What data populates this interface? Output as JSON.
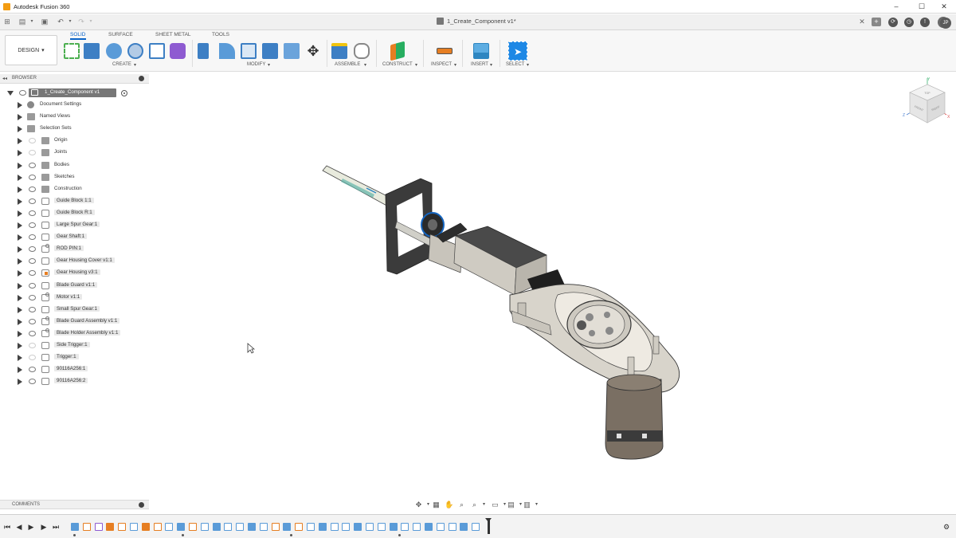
{
  "window": {
    "app_title": "Autodesk Fusion 360",
    "document_title": "1_Create_Component v1*",
    "user_initials": "JP"
  },
  "toolbar": {
    "workspace_label": "DESIGN",
    "tabs": [
      "SOLID",
      "SURFACE",
      "SHEET METAL",
      "TOOLS"
    ],
    "active_tab": "SOLID",
    "groups": [
      "CREATE",
      "MODIFY",
      "ASSEMBLE",
      "CONSTRUCT",
      "INSPECT",
      "INSERT",
      "SELECT"
    ]
  },
  "browser": {
    "header": "BROWSER",
    "root": "1_Create_Component v1",
    "items": [
      {
        "label": "Document Settings"
      },
      {
        "label": "Named Views"
      },
      {
        "label": "Selection Sets"
      },
      {
        "label": "Origin"
      },
      {
        "label": "Joints"
      },
      {
        "label": "Bodies"
      },
      {
        "label": "Sketches"
      },
      {
        "label": "Construction"
      },
      {
        "label": "Guide Block 1:1"
      },
      {
        "label": "Guide Block R:1"
      },
      {
        "label": "Large Spur Gear:1"
      },
      {
        "label": "Gear Shaft:1"
      },
      {
        "label": "ROD PIN:1"
      },
      {
        "label": "Gear Housing Cover v1:1"
      },
      {
        "label": "Gear Housing v3:1"
      },
      {
        "label": "Blade Guard v1:1"
      },
      {
        "label": "Motor v1:1"
      },
      {
        "label": "Small Spur Gear:1"
      },
      {
        "label": "Blade Guard Assembly v1:1"
      },
      {
        "label": "Blade Holder Assembly v1:1"
      },
      {
        "label": "Side Trigger:1"
      },
      {
        "label": "Trigger:1"
      },
      {
        "label": "90116A256:1"
      },
      {
        "label": "90116A256:2"
      }
    ]
  },
  "viewcube": {
    "top": "TOP",
    "front": "FRONT",
    "right": "RIGHT",
    "axis_x": "X",
    "axis_y": "Y",
    "axis_z": "Z"
  },
  "comments": {
    "header": "COMMENTS"
  },
  "colors": {
    "accent": "#0a64c8",
    "panel": "#f0f0f0",
    "select_icon": "#1e88e5"
  },
  "icons": {
    "timeline_controls": [
      "skip-to-start-icon",
      "step-back-icon",
      "play-icon",
      "step-forward-icon",
      "skip-to-end-icon"
    ],
    "nav": [
      "orbit-icon",
      "look-at-icon",
      "pan-icon",
      "zoom-window-icon",
      "zoom-icon",
      "display-settings-icon",
      "grid-icon",
      "viewports-icon"
    ]
  }
}
